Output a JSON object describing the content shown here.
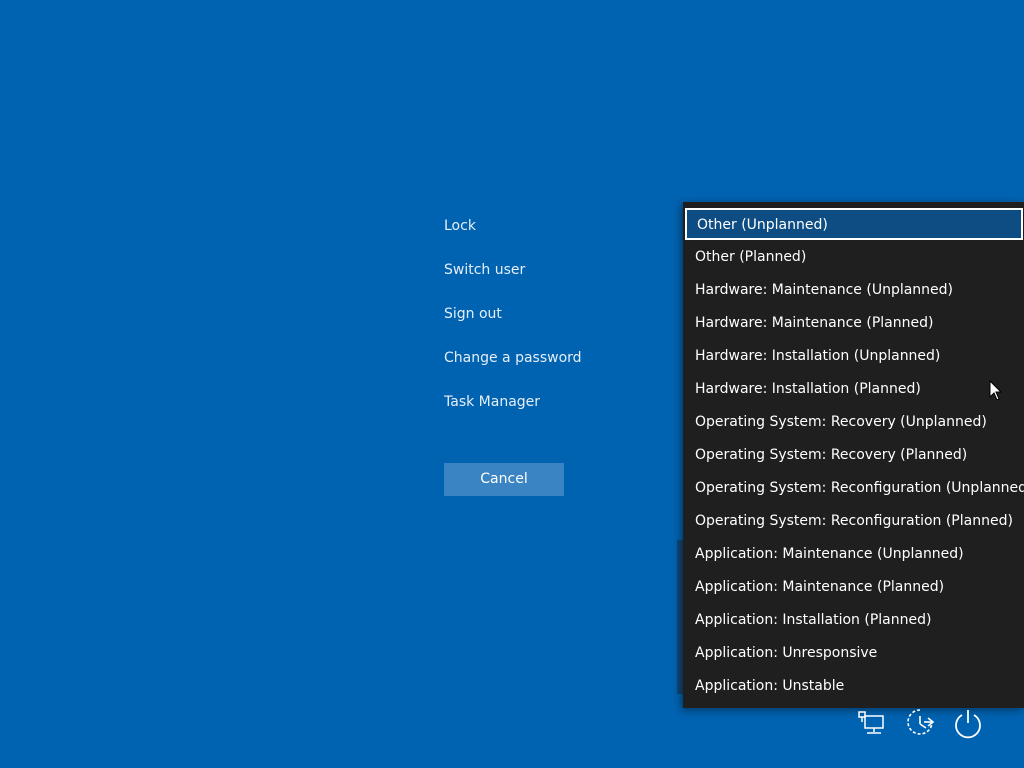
{
  "power_options": [
    {
      "label": "Lock",
      "name": "option-lock"
    },
    {
      "label": "Switch user",
      "name": "option-switch-user"
    },
    {
      "label": "Sign out",
      "name": "option-sign-out"
    },
    {
      "label": "Change a password",
      "name": "option-change-password"
    },
    {
      "label": "Task Manager",
      "name": "option-task-manager"
    }
  ],
  "cancel_label": "Cancel",
  "shutdown_reasons": {
    "selected_index": 0,
    "items": [
      "Other (Unplanned)",
      "Other (Planned)",
      "Hardware: Maintenance (Unplanned)",
      "Hardware: Maintenance (Planned)",
      "Hardware: Installation (Unplanned)",
      "Hardware: Installation (Planned)",
      "Operating System: Recovery (Unplanned)",
      "Operating System: Recovery (Planned)",
      "Operating System: Reconfiguration (Unplanned)",
      "Operating System: Reconfiguration (Planned)",
      "Application: Maintenance (Unplanned)",
      "Application: Maintenance (Planned)",
      "Application: Installation (Planned)",
      "Application: Unresponsive",
      "Application: Unstable"
    ]
  },
  "tray_icons": [
    "network-icon",
    "ease-of-access-icon",
    "power-icon"
  ],
  "colors": {
    "background": "#0063b1",
    "menu_background": "#1f1f1f",
    "selected_background": "#0e4d84",
    "cancel_button": "#3b84c3"
  }
}
